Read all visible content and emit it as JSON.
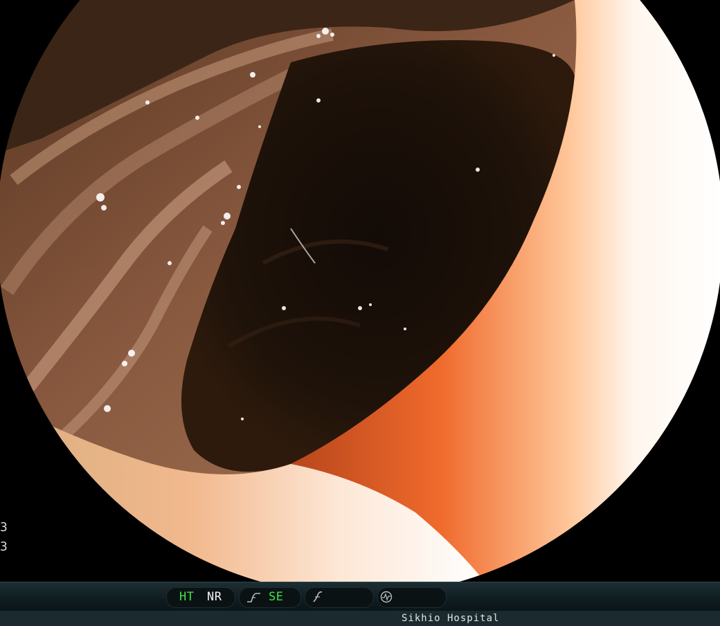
{
  "toolbar": {
    "ht_label": "HT",
    "nr_label": "NR",
    "se_label": "SE",
    "ht_color": "#43e343",
    "se_color": "#43e343",
    "nr_color": "#f2f2f2",
    "icons": [
      "enhancement-curve-icon",
      "gamma-icon",
      "waveform-icon"
    ]
  },
  "left_edge_marks": [
    "3",
    "3"
  ],
  "footer": {
    "hospital_name": "Sikhio Hospital"
  }
}
